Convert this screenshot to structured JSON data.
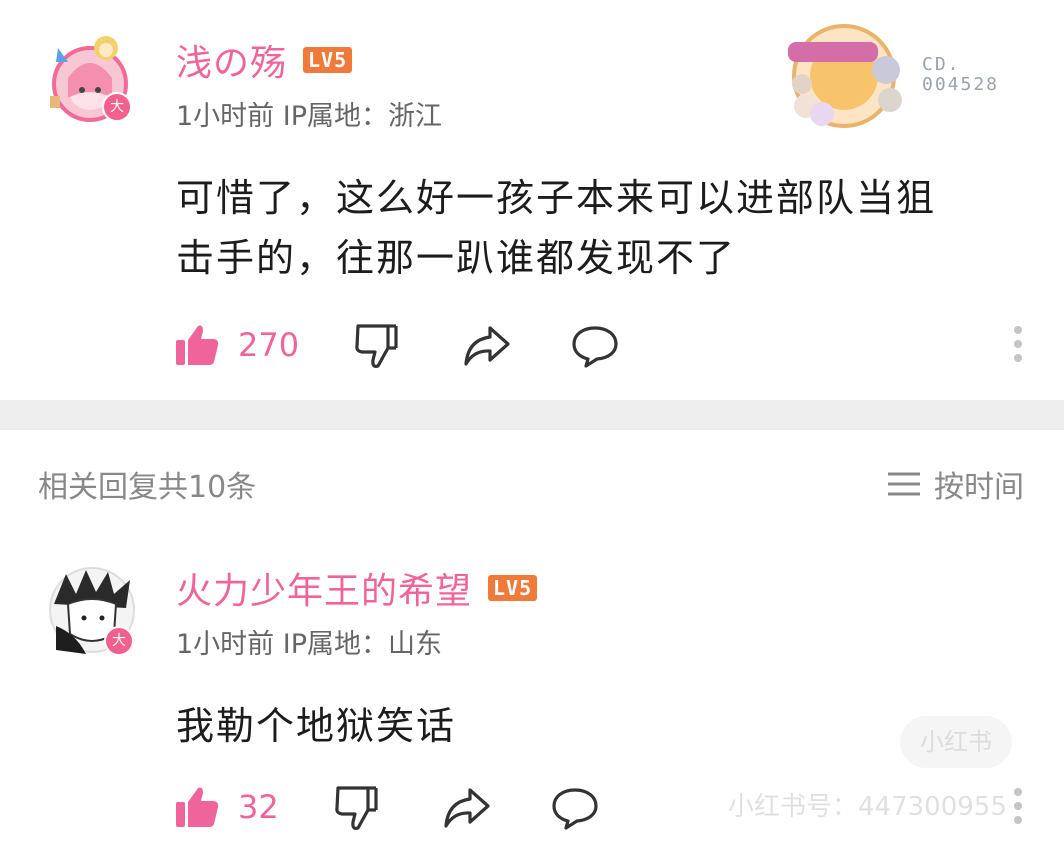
{
  "comment": {
    "username": "浅の殇",
    "level": "LV5",
    "meta": "1小时前 IP属地：浙江",
    "content_line1": "可惜了，这么好一孩子本来可以进部队当狙",
    "content_line2": "击手的，往那一趴谁都发现不了",
    "likes": "270",
    "badge_code": "CD.",
    "badge_number": "004528",
    "avatar_badge": "大"
  },
  "replies_header": {
    "label": "相关回复共10条",
    "sort_label": "按时间"
  },
  "reply": {
    "username": "火力少年王的希望",
    "level": "LV5",
    "meta": "1小时前 IP属地：山东",
    "content": "我勒个地狱笑话",
    "likes": "32",
    "avatar_badge": "大"
  },
  "watermark": {
    "logo": "小红书",
    "id_text": "小红书号：447300955"
  },
  "colors": {
    "accent": "#f0649c",
    "level_badge": "#f07a3a",
    "divider": "#eeeeef"
  }
}
